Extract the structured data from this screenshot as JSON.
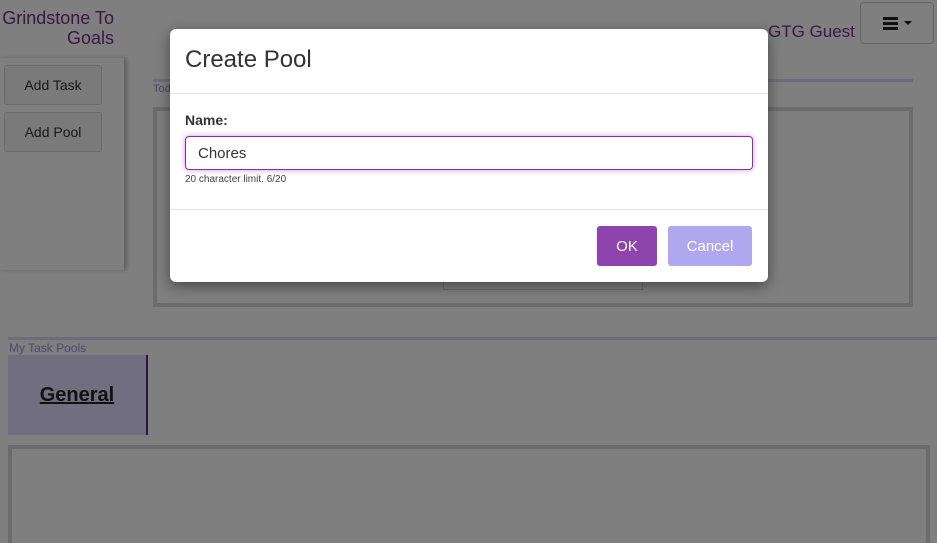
{
  "app": {
    "brand": "Grindstone To Goals",
    "user": "GTG Guest",
    "menu_icon": "hamburger-icon",
    "sidebar": {
      "add_task_label": "Add Task",
      "add_pool_label": "Add Pool"
    },
    "today_label": "Tod",
    "pools_section_label": "My Task Pools",
    "pools": [
      {
        "name": "General"
      }
    ]
  },
  "modal": {
    "title": "Create Pool",
    "name_label": "Name:",
    "name_value": "Chores",
    "char_hint": "20 character limit. 6/20",
    "ok_label": "OK",
    "cancel_label": "Cancel"
  },
  "colors": {
    "accent": "#8e44ad",
    "cancel": "#b0a8ee",
    "brand_text": "#7a2d91",
    "pool_card": "#e0dcff"
  }
}
